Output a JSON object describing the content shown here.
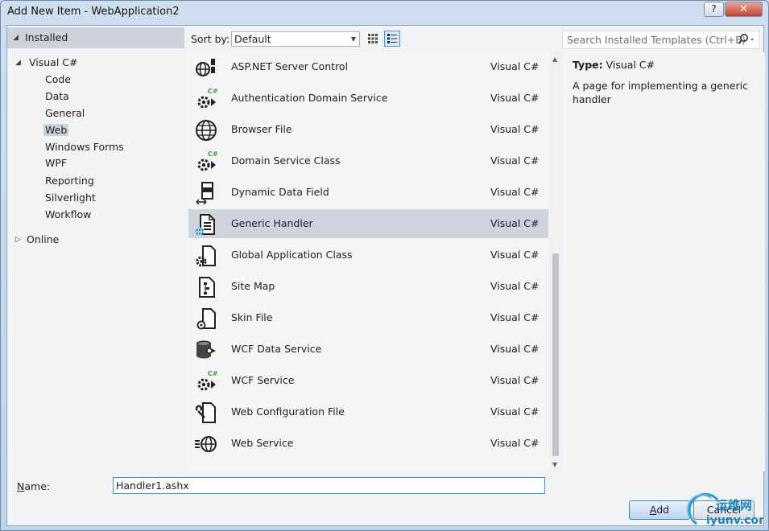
{
  "window": {
    "title": "Add New Item - WebApplication2",
    "help_label": "?",
    "close_label": "✕"
  },
  "tree": {
    "installed": "Installed",
    "visual_csharp": "Visual C#",
    "children": [
      "Code",
      "Data",
      "General",
      "Web",
      "Windows Forms",
      "WPF",
      "Reporting",
      "Silverlight",
      "Workflow"
    ],
    "selected": "Web",
    "online": "Online"
  },
  "sort": {
    "label": "Sort by:",
    "value": "Default"
  },
  "search": {
    "placeholder": "Search Installed Templates (Ctrl+E)"
  },
  "templates": [
    {
      "name": "ASP.NET Server Control",
      "lang": "Visual C#",
      "icon": "server-control-icon"
    },
    {
      "name": "Authentication Domain Service",
      "lang": "Visual C#",
      "icon": "csharp-gear-icon"
    },
    {
      "name": "Browser File",
      "lang": "Visual C#",
      "icon": "globe-icon"
    },
    {
      "name": "Domain Service Class",
      "lang": "Visual C#",
      "icon": "csharp-gear-icon"
    },
    {
      "name": "Dynamic Data Field",
      "lang": "Visual C#",
      "icon": "data-field-icon"
    },
    {
      "name": "Generic Handler",
      "lang": "Visual C#",
      "icon": "handler-icon"
    },
    {
      "name": "Global Application Class",
      "lang": "Visual C#",
      "icon": "gear-document-icon"
    },
    {
      "name": "Site Map",
      "lang": "Visual C#",
      "icon": "sitemap-icon"
    },
    {
      "name": "Skin File",
      "lang": "Visual C#",
      "icon": "skin-file-icon"
    },
    {
      "name": "WCF Data Service",
      "lang": "Visual C#",
      "icon": "database-icon"
    },
    {
      "name": "WCF Service",
      "lang": "Visual C#",
      "icon": "csharp-gear-icon"
    },
    {
      "name": "Web Configuration File",
      "lang": "Visual C#",
      "icon": "config-icon"
    },
    {
      "name": "Web Service",
      "lang": "Visual C#",
      "icon": "web-service-icon"
    }
  ],
  "selected_template": "Generic Handler",
  "details": {
    "type_label": "Type:",
    "type_value": "Visual C#",
    "description": "A page for implementing a generic handler"
  },
  "name_field": {
    "label_prefix": "N",
    "label_rest": "ame:",
    "value": "Handler1.ashx"
  },
  "buttons": {
    "add_accel": "A",
    "add_rest": "dd",
    "cancel": "Cancel"
  },
  "watermark": {
    "line1": "运维网",
    "line2": "iyunv.com"
  },
  "colors": {
    "selection": "#cfd3dc",
    "accent": "#3a8ee6",
    "csharp_badge": "#3c9a3c"
  }
}
